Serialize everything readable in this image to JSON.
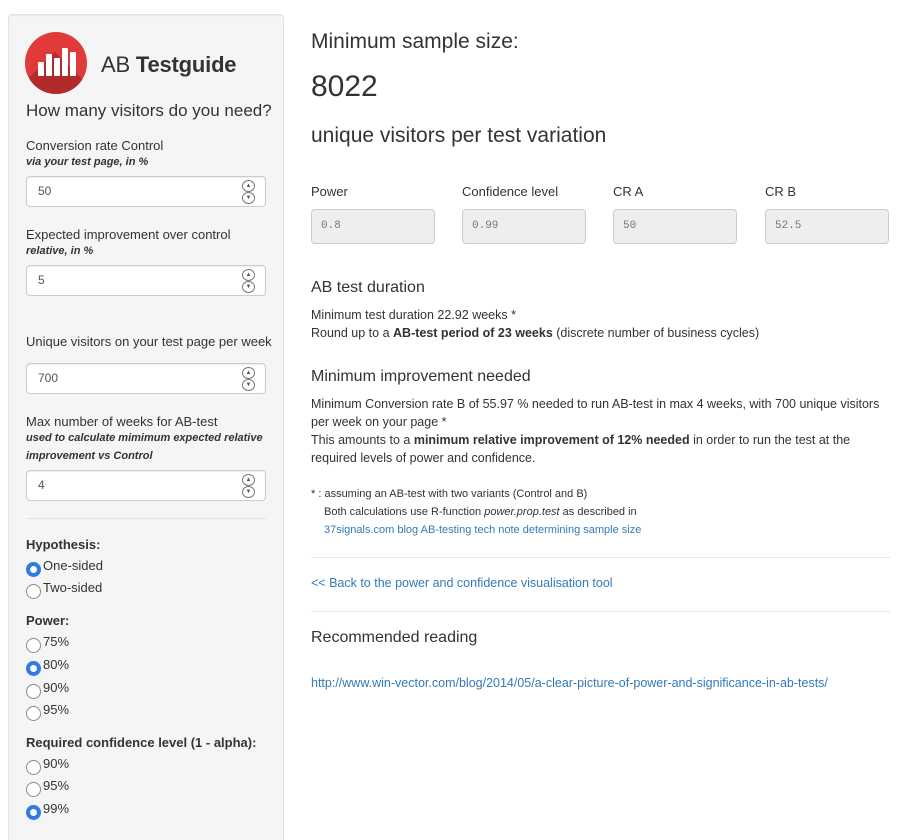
{
  "brand": {
    "name_light": "AB",
    "name_bold": "Testguide"
  },
  "sidebar": {
    "question": "How many visitors do you need?",
    "fields": [
      {
        "label": "Conversion rate Control",
        "sub": "via your test page, in %",
        "value": "50"
      },
      {
        "label": "Expected improvement over control",
        "sub": "relative, in %",
        "value": "5"
      },
      {
        "label": "Unique visitors on your test page per week",
        "sub": "",
        "value": "700"
      },
      {
        "label": "Max number of weeks for AB-test",
        "sub": "used to calculate mimimum expected relative improvement vs Control",
        "value": "4"
      }
    ],
    "hypothesis": {
      "title": "Hypothesis:",
      "options": [
        "One-sided",
        "Two-sided"
      ],
      "selected": "One-sided"
    },
    "power": {
      "title": "Power:",
      "options": [
        "75%",
        "80%",
        "90%",
        "95%"
      ],
      "selected": "80%"
    },
    "confidence": {
      "title": "Required confidence level (1 - alpha):",
      "options": [
        "90%",
        "95%",
        "99%"
      ],
      "selected": "99%"
    }
  },
  "main": {
    "heading": "Minimum sample size:",
    "sample_size": "8022",
    "unit": "unique visitors per test variation",
    "params": [
      {
        "label": "Power",
        "value": "0.8"
      },
      {
        "label": "Confidence level",
        "value": "0.99"
      },
      {
        "label": "CR A",
        "value": "50"
      },
      {
        "label": "CR B",
        "value": "52.5"
      }
    ],
    "duration": {
      "title": "AB test duration",
      "line1": "Minimum test duration 22.92 weeks *",
      "line2_pre": "Round up to a ",
      "line2_bold": "AB-test period of 23 weeks",
      "line2_post": " (discrete number of business cycles)"
    },
    "improvement": {
      "title": "Minimum improvement needed",
      "text1": "Minimum Conversion rate B of 55.97 % needed to run AB-test in max 4 weeks, with 700 unique visitors per week on your page *",
      "text2_pre": "This amounts to a ",
      "text2_bold": "minimum relative improvement of 12% needed",
      "text2_post": " in order to run the test at the required levels of power and confidence."
    },
    "footnote": {
      "line1": "* : assuming an AB-test with two variants (Control and B)",
      "line2_pre": "Both calculations use R-function ",
      "line2_italic": "power.prop.test",
      "line2_post": " as described in",
      "link": "37signals.com blog AB-testing tech note determining sample size"
    },
    "back_link": "<< Back to the power and confidence visualisation tool",
    "reading": {
      "title": "Recommended reading",
      "link": "http://www.win-vector.com/blog/2014/05/a-clear-picture-of-power-and-significance-in-ab-tests/"
    }
  },
  "colors": {
    "accent": "#337ab7",
    "radio": "#2f7ae5",
    "logo": "#e03a3a"
  }
}
